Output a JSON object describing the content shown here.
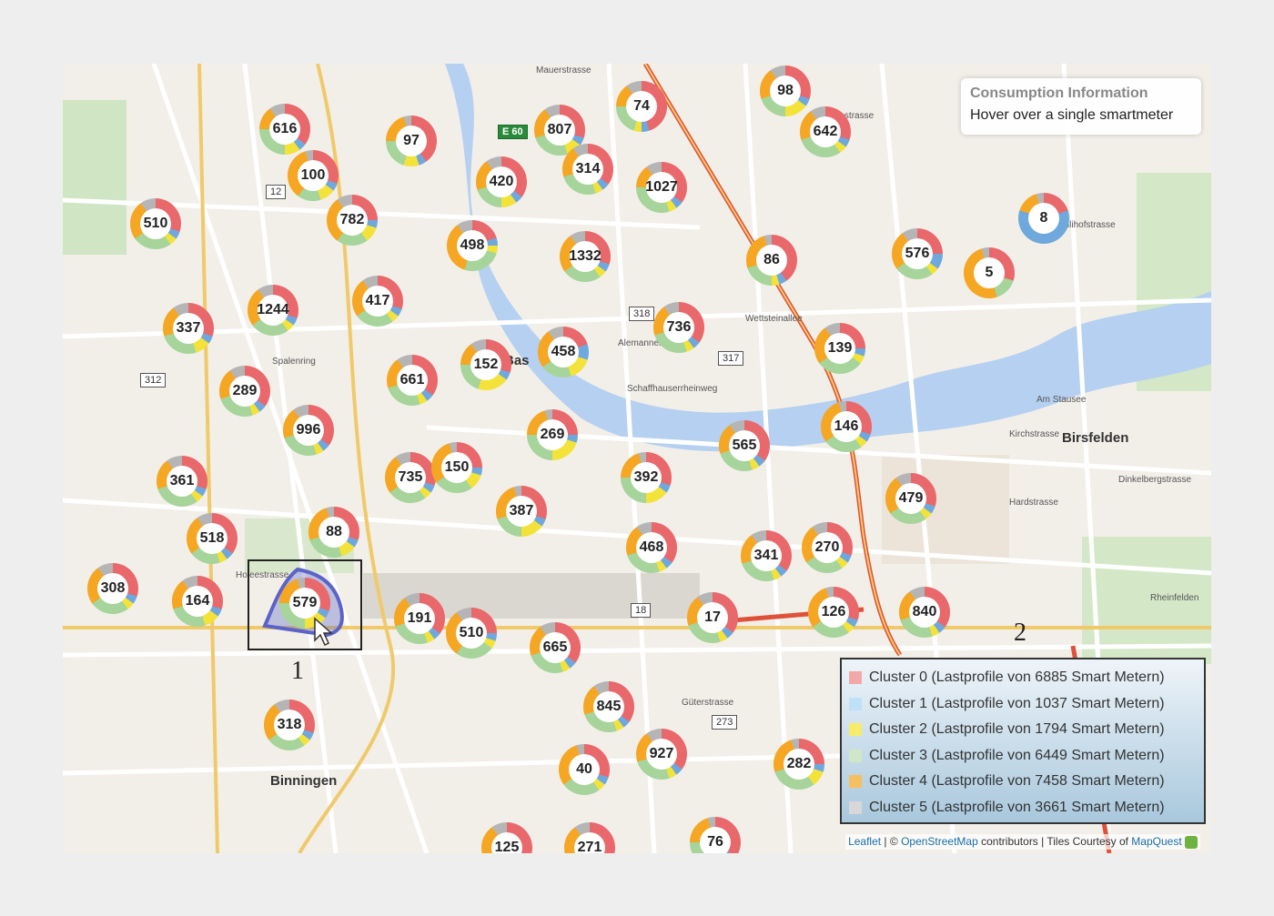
{
  "info": {
    "title": "Consumption Information",
    "text": "Hover over a single smartmeter"
  },
  "legend": [
    {
      "label": "Cluster 0 (Lastprofile von 6885 Smart Metern)",
      "color": "#f2a8a8"
    },
    {
      "label": "Cluster 1 (Lastprofile von 1037 Smart Metern)",
      "color": "#bfe0f5"
    },
    {
      "label": "Cluster 2 (Lastprofile von 1794 Smart Metern)",
      "color": "#f7ec6a"
    },
    {
      "label": "Cluster 3 (Lastprofile von 6449 Smart Metern)",
      "color": "#cfe7c8"
    },
    {
      "label": "Cluster 4 (Lastprofile von 7458 Smart Metern)",
      "color": "#f6c060"
    },
    {
      "label": "Cluster 5 (Lastprofile von 3661 Smart Metern)",
      "color": "#d8d8d8"
    }
  ],
  "segment_colors": {
    "red": "#e8686b",
    "blue": "#6fa8dc",
    "yellow": "#f3e23a",
    "green": "#a6d49a",
    "orange": "#f5a623",
    "gray": "#b5b5b5"
  },
  "attribution": {
    "leaflet": "Leaflet",
    "sep1": " | © ",
    "osm": "OpenStreetMap",
    "contrib": " contributors | Tiles Courtesy of ",
    "mapquest": "MapQuest"
  },
  "places": [
    "Binningen",
    "Birsfelden",
    "Bas"
  ],
  "shields": [
    "12",
    "312",
    "318",
    "317",
    "18",
    "273",
    "E 60"
  ],
  "annotations": [
    "1",
    "2"
  ],
  "clusters": [
    {
      "n": "616",
      "mix": [
        35,
        5,
        10,
        25,
        15,
        10
      ]
    },
    {
      "n": "97",
      "mix": [
        40,
        5,
        10,
        20,
        20,
        5
      ]
    },
    {
      "n": "807",
      "mix": [
        30,
        5,
        10,
        25,
        20,
        10
      ]
    },
    {
      "n": "74",
      "mix": [
        45,
        5,
        5,
        20,
        15,
        10
      ]
    },
    {
      "n": "98",
      "mix": [
        30,
        5,
        15,
        20,
        20,
        10
      ]
    },
    {
      "n": "642",
      "mix": [
        30,
        5,
        5,
        30,
        20,
        10
      ]
    },
    {
      "n": "100",
      "mix": [
        30,
        5,
        10,
        15,
        35,
        5
      ]
    },
    {
      "n": "314",
      "mix": [
        35,
        5,
        5,
        25,
        20,
        10
      ]
    },
    {
      "n": "420",
      "mix": [
        35,
        5,
        10,
        20,
        20,
        10
      ]
    },
    {
      "n": "1027",
      "mix": [
        35,
        5,
        5,
        30,
        15,
        10
      ]
    },
    {
      "n": "510",
      "mix": [
        30,
        5,
        5,
        25,
        25,
        10
      ]
    },
    {
      "n": "782",
      "mix": [
        25,
        5,
        10,
        20,
        30,
        10
      ]
    },
    {
      "n": "498",
      "mix": [
        20,
        5,
        5,
        25,
        35,
        10
      ]
    },
    {
      "n": "1332",
      "mix": [
        30,
        5,
        5,
        25,
        25,
        10
      ]
    },
    {
      "n": "8",
      "mix": [
        20,
        60,
        0,
        0,
        15,
        5
      ]
    },
    {
      "n": "576",
      "mix": [
        25,
        10,
        5,
        25,
        25,
        10
      ]
    },
    {
      "n": "86",
      "mix": [
        40,
        5,
        5,
        20,
        25,
        5
      ]
    },
    {
      "n": "5",
      "mix": [
        30,
        0,
        0,
        15,
        50,
        5
      ]
    },
    {
      "n": "1244",
      "mix": [
        30,
        5,
        5,
        25,
        25,
        10
      ]
    },
    {
      "n": "417",
      "mix": [
        30,
        5,
        5,
        25,
        25,
        10
      ]
    },
    {
      "n": "337",
      "mix": [
        30,
        5,
        10,
        25,
        20,
        10
      ]
    },
    {
      "n": "736",
      "mix": [
        35,
        5,
        5,
        25,
        20,
        10
      ]
    },
    {
      "n": "458",
      "mix": [
        20,
        10,
        15,
        20,
        25,
        10
      ]
    },
    {
      "n": "152",
      "mix": [
        30,
        5,
        20,
        20,
        15,
        10
      ]
    },
    {
      "n": "139",
      "mix": [
        25,
        5,
        5,
        30,
        25,
        10
      ]
    },
    {
      "n": "661",
      "mix": [
        35,
        5,
        5,
        25,
        20,
        10
      ]
    },
    {
      "n": "289",
      "mix": [
        35,
        5,
        5,
        25,
        20,
        10
      ]
    },
    {
      "n": "996",
      "mix": [
        35,
        5,
        5,
        25,
        20,
        10
      ]
    },
    {
      "n": "269",
      "mix": [
        25,
        5,
        20,
        25,
        20,
        5
      ]
    },
    {
      "n": "565",
      "mix": [
        35,
        5,
        5,
        25,
        20,
        10
      ]
    },
    {
      "n": "146",
      "mix": [
        30,
        5,
        5,
        25,
        30,
        5
      ]
    },
    {
      "n": "361",
      "mix": [
        30,
        5,
        5,
        30,
        20,
        10
      ]
    },
    {
      "n": "735",
      "mix": [
        30,
        5,
        5,
        25,
        25,
        10
      ]
    },
    {
      "n": "150",
      "mix": [
        25,
        5,
        10,
        25,
        30,
        5
      ]
    },
    {
      "n": "392",
      "mix": [
        30,
        5,
        15,
        25,
        20,
        5
      ]
    },
    {
      "n": "479",
      "mix": [
        30,
        5,
        5,
        25,
        25,
        10
      ]
    },
    {
      "n": "387",
      "mix": [
        30,
        5,
        15,
        20,
        25,
        5
      ]
    },
    {
      "n": "518",
      "mix": [
        35,
        5,
        5,
        20,
        25,
        10
      ]
    },
    {
      "n": "88",
      "mix": [
        30,
        5,
        10,
        25,
        25,
        5
      ]
    },
    {
      "n": "468",
      "mix": [
        35,
        5,
        5,
        25,
        20,
        10
      ]
    },
    {
      "n": "341",
      "mix": [
        35,
        5,
        5,
        25,
        20,
        10
      ]
    },
    {
      "n": "270",
      "mix": [
        30,
        5,
        5,
        25,
        25,
        10
      ]
    },
    {
      "n": "308",
      "mix": [
        30,
        5,
        5,
        25,
        25,
        10
      ]
    },
    {
      "n": "164",
      "mix": [
        30,
        5,
        10,
        25,
        20,
        10
      ]
    },
    {
      "n": "579",
      "mix": [
        30,
        5,
        15,
        25,
        20,
        5
      ]
    },
    {
      "n": "191",
      "mix": [
        35,
        5,
        5,
        25,
        20,
        10
      ]
    },
    {
      "n": "510",
      "mix": [
        25,
        5,
        5,
        25,
        30,
        10
      ]
    },
    {
      "n": "17",
      "mix": [
        35,
        5,
        5,
        25,
        20,
        10
      ]
    },
    {
      "n": "126",
      "mix": [
        30,
        5,
        5,
        25,
        30,
        5
      ]
    },
    {
      "n": "840",
      "mix": [
        35,
        5,
        5,
        25,
        20,
        10
      ]
    },
    {
      "n": "665",
      "mix": [
        35,
        5,
        5,
        25,
        20,
        10
      ]
    },
    {
      "n": "845",
      "mix": [
        35,
        5,
        5,
        25,
        20,
        10
      ]
    },
    {
      "n": "318",
      "mix": [
        30,
        5,
        5,
        25,
        25,
        10
      ]
    },
    {
      "n": "927",
      "mix": [
        35,
        5,
        5,
        25,
        20,
        10
      ]
    },
    {
      "n": "40",
      "mix": [
        30,
        5,
        5,
        25,
        30,
        5
      ]
    },
    {
      "n": "282",
      "mix": [
        25,
        5,
        10,
        30,
        25,
        5
      ]
    },
    {
      "n": "76",
      "mix": [
        35,
        5,
        10,
        25,
        20,
        5
      ]
    },
    {
      "n": "125",
      "mix": [
        30,
        5,
        5,
        25,
        25,
        10
      ]
    },
    {
      "n": "271",
      "mix": [
        35,
        5,
        5,
        25,
        20,
        10
      ]
    }
  ]
}
